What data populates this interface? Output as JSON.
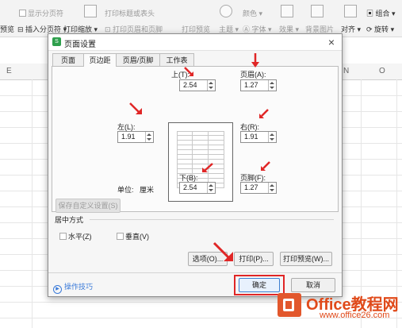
{
  "toolbar": {
    "items": [
      {
        "label": "显示分页符",
        "dim": true
      },
      {
        "label": "打印标题或表头",
        "dim": true
      },
      {
        "label": "颜色",
        "dim": true
      },
      {
        "label": "组合",
        "dim": false
      },
      {
        "label": "预览",
        "dim": false
      },
      {
        "label": "插入分页符",
        "dim": false
      },
      {
        "label": "打印缩放",
        "dim": false
      },
      {
        "label": "打印页眉和页脚",
        "dim": true
      },
      {
        "label": "打印预览",
        "dim": true
      },
      {
        "label": "主题",
        "dim": true
      },
      {
        "label": "字体",
        "dim": true
      },
      {
        "label": "效果",
        "dim": true
      },
      {
        "label": "背景图片",
        "dim": true
      },
      {
        "label": "对齐",
        "dim": false
      },
      {
        "label": "旋转",
        "dim": false
      }
    ]
  },
  "sheet": {
    "columns": [
      "E",
      "N",
      "O"
    ]
  },
  "dialog": {
    "title": "页面设置",
    "close_glyph": "×",
    "tabs": [
      {
        "label": "页面",
        "active": false
      },
      {
        "label": "页边距",
        "active": true
      },
      {
        "label": "页眉/页脚",
        "active": false
      },
      {
        "label": "工作表",
        "active": false
      }
    ],
    "margins": {
      "top": {
        "label": "上(T):",
        "value": "2.54"
      },
      "header": {
        "label": "页眉(A):",
        "value": "1.27"
      },
      "left": {
        "label": "左(L):",
        "value": "1.91"
      },
      "right": {
        "label": "右(R):",
        "value": "1.91"
      },
      "bottom": {
        "label": "下(B):",
        "value": "2.54"
      },
      "footer": {
        "label": "页脚(F):",
        "value": "1.27"
      }
    },
    "unit_label": "单位:",
    "unit_value": "厘米",
    "save_custom_label": "保存自定义设置(S)",
    "center_title": "居中方式",
    "horizontal_label": "水平(Z)",
    "horizontal_checked": false,
    "vertical_label": "垂直(V)",
    "vertical_checked": false,
    "options_label": "选项(O)...",
    "print_label": "打印(P)...",
    "print_preview_label": "打印预览(W)...",
    "tips_label": "操作技巧",
    "ok_label": "确定",
    "cancel_label": "取消"
  },
  "watermark": {
    "title": "Office教程网",
    "subtitle": "www.office26.com"
  },
  "colors": {
    "accent": "#e02626",
    "brand": "#e04a1a",
    "link": "#3a7ad9"
  }
}
